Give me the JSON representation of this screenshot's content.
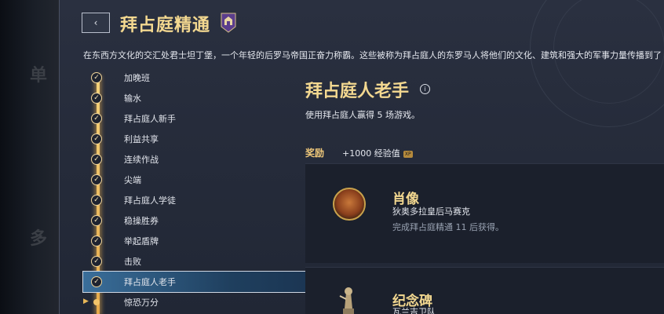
{
  "background_left": {
    "ghost_top": "单",
    "ghost_bottom": "多"
  },
  "header": {
    "back_label": "‹",
    "title": "拜占庭精通",
    "description": "在东西方文化的交汇处君士坦丁堡，一个年轻的后罗马帝国正奋力称霸。这些被称为拜占庭人的东罗马人将他们的文化、建筑和强大的军事力量传播到了"
  },
  "list": {
    "items": [
      {
        "label": "加晚班",
        "state": "done"
      },
      {
        "label": "输水",
        "state": "done"
      },
      {
        "label": "拜占庭人新手",
        "state": "done"
      },
      {
        "label": "利益共享",
        "state": "done"
      },
      {
        "label": "连续作战",
        "state": "done"
      },
      {
        "label": "尖端",
        "state": "done"
      },
      {
        "label": "拜占庭人学徒",
        "state": "done"
      },
      {
        "label": "稳操胜券",
        "state": "done"
      },
      {
        "label": "举起盾牌",
        "state": "done"
      },
      {
        "label": "击败",
        "state": "done"
      },
      {
        "label": "拜占庭人老手",
        "state": "selected"
      },
      {
        "label": "惊恐万分",
        "state": "next"
      }
    ]
  },
  "detail": {
    "title": "拜占庭人老手",
    "info_icon": "info-icon",
    "description": "使用拜占庭人赢得 5 场游戏。",
    "reward_label": "奖励",
    "xp_text": "+1000 经验值",
    "xp_badge": "XP",
    "rewards": [
      {
        "icon": "portrait-icon",
        "name": "肖像",
        "subtitle": "狄奥多拉皇后马赛克",
        "note": "完成拜占庭精通 11 后获得。"
      },
      {
        "icon": "monument-icon",
        "name": "纪念碑",
        "subtitle": "瓦兰吉卫队"
      }
    ]
  },
  "colors": {
    "gold": "#f3d890",
    "selected": "#3a6e9a",
    "timeline": "#f5d27a"
  }
}
